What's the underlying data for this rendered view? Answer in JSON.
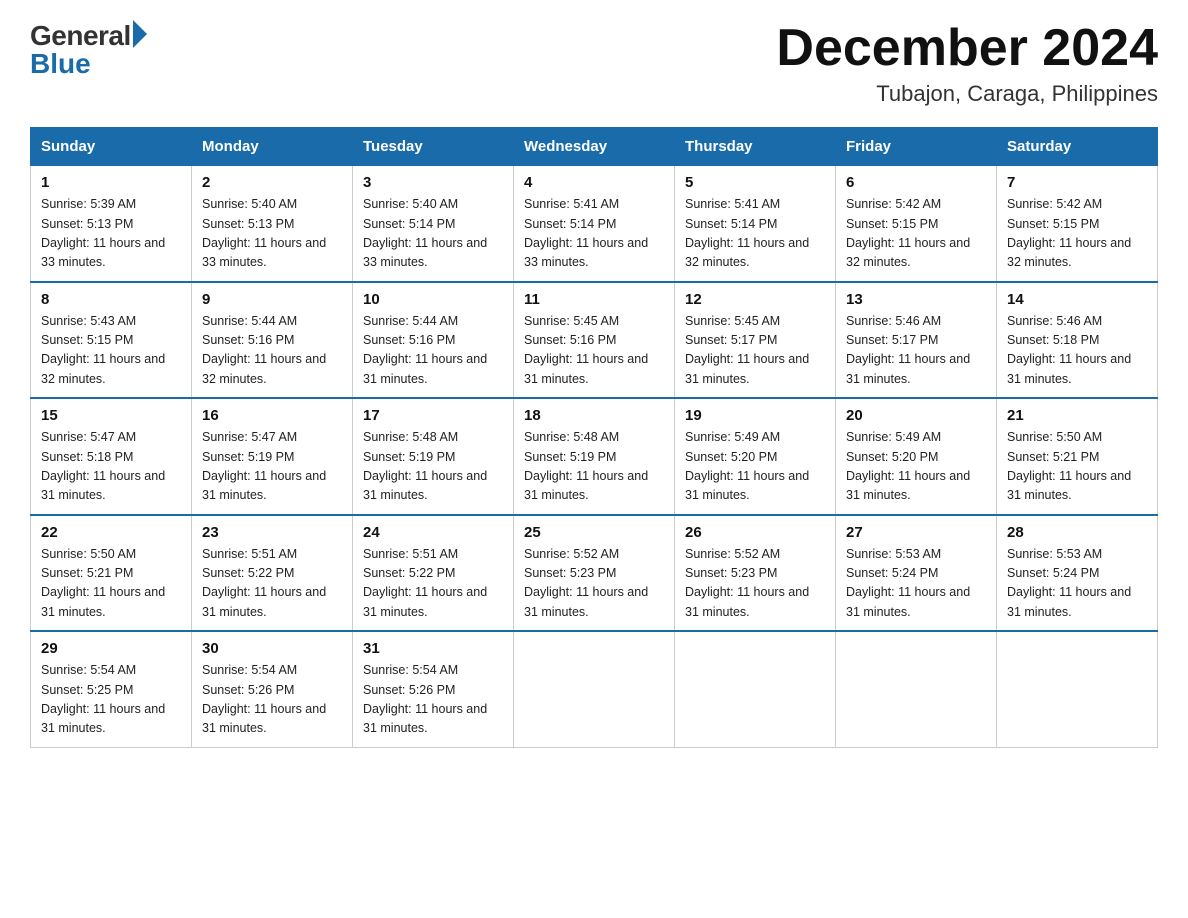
{
  "logo": {
    "general": "General",
    "blue": "Blue"
  },
  "header": {
    "month": "December 2024",
    "location": "Tubajon, Caraga, Philippines"
  },
  "days_of_week": [
    "Sunday",
    "Monday",
    "Tuesday",
    "Wednesday",
    "Thursday",
    "Friday",
    "Saturday"
  ],
  "weeks": [
    [
      {
        "day": "1",
        "sunrise": "5:39 AM",
        "sunset": "5:13 PM",
        "daylight": "11 hours and 33 minutes."
      },
      {
        "day": "2",
        "sunrise": "5:40 AM",
        "sunset": "5:13 PM",
        "daylight": "11 hours and 33 minutes."
      },
      {
        "day": "3",
        "sunrise": "5:40 AM",
        "sunset": "5:14 PM",
        "daylight": "11 hours and 33 minutes."
      },
      {
        "day": "4",
        "sunrise": "5:41 AM",
        "sunset": "5:14 PM",
        "daylight": "11 hours and 33 minutes."
      },
      {
        "day": "5",
        "sunrise": "5:41 AM",
        "sunset": "5:14 PM",
        "daylight": "11 hours and 32 minutes."
      },
      {
        "day": "6",
        "sunrise": "5:42 AM",
        "sunset": "5:15 PM",
        "daylight": "11 hours and 32 minutes."
      },
      {
        "day": "7",
        "sunrise": "5:42 AM",
        "sunset": "5:15 PM",
        "daylight": "11 hours and 32 minutes."
      }
    ],
    [
      {
        "day": "8",
        "sunrise": "5:43 AM",
        "sunset": "5:15 PM",
        "daylight": "11 hours and 32 minutes."
      },
      {
        "day": "9",
        "sunrise": "5:44 AM",
        "sunset": "5:16 PM",
        "daylight": "11 hours and 32 minutes."
      },
      {
        "day": "10",
        "sunrise": "5:44 AM",
        "sunset": "5:16 PM",
        "daylight": "11 hours and 31 minutes."
      },
      {
        "day": "11",
        "sunrise": "5:45 AM",
        "sunset": "5:16 PM",
        "daylight": "11 hours and 31 minutes."
      },
      {
        "day": "12",
        "sunrise": "5:45 AM",
        "sunset": "5:17 PM",
        "daylight": "11 hours and 31 minutes."
      },
      {
        "day": "13",
        "sunrise": "5:46 AM",
        "sunset": "5:17 PM",
        "daylight": "11 hours and 31 minutes."
      },
      {
        "day": "14",
        "sunrise": "5:46 AM",
        "sunset": "5:18 PM",
        "daylight": "11 hours and 31 minutes."
      }
    ],
    [
      {
        "day": "15",
        "sunrise": "5:47 AM",
        "sunset": "5:18 PM",
        "daylight": "11 hours and 31 minutes."
      },
      {
        "day": "16",
        "sunrise": "5:47 AM",
        "sunset": "5:19 PM",
        "daylight": "11 hours and 31 minutes."
      },
      {
        "day": "17",
        "sunrise": "5:48 AM",
        "sunset": "5:19 PM",
        "daylight": "11 hours and 31 minutes."
      },
      {
        "day": "18",
        "sunrise": "5:48 AM",
        "sunset": "5:19 PM",
        "daylight": "11 hours and 31 minutes."
      },
      {
        "day": "19",
        "sunrise": "5:49 AM",
        "sunset": "5:20 PM",
        "daylight": "11 hours and 31 minutes."
      },
      {
        "day": "20",
        "sunrise": "5:49 AM",
        "sunset": "5:20 PM",
        "daylight": "11 hours and 31 minutes."
      },
      {
        "day": "21",
        "sunrise": "5:50 AM",
        "sunset": "5:21 PM",
        "daylight": "11 hours and 31 minutes."
      }
    ],
    [
      {
        "day": "22",
        "sunrise": "5:50 AM",
        "sunset": "5:21 PM",
        "daylight": "11 hours and 31 minutes."
      },
      {
        "day": "23",
        "sunrise": "5:51 AM",
        "sunset": "5:22 PM",
        "daylight": "11 hours and 31 minutes."
      },
      {
        "day": "24",
        "sunrise": "5:51 AM",
        "sunset": "5:22 PM",
        "daylight": "11 hours and 31 minutes."
      },
      {
        "day": "25",
        "sunrise": "5:52 AM",
        "sunset": "5:23 PM",
        "daylight": "11 hours and 31 minutes."
      },
      {
        "day": "26",
        "sunrise": "5:52 AM",
        "sunset": "5:23 PM",
        "daylight": "11 hours and 31 minutes."
      },
      {
        "day": "27",
        "sunrise": "5:53 AM",
        "sunset": "5:24 PM",
        "daylight": "11 hours and 31 minutes."
      },
      {
        "day": "28",
        "sunrise": "5:53 AM",
        "sunset": "5:24 PM",
        "daylight": "11 hours and 31 minutes."
      }
    ],
    [
      {
        "day": "29",
        "sunrise": "5:54 AM",
        "sunset": "5:25 PM",
        "daylight": "11 hours and 31 minutes."
      },
      {
        "day": "30",
        "sunrise": "5:54 AM",
        "sunset": "5:26 PM",
        "daylight": "11 hours and 31 minutes."
      },
      {
        "day": "31",
        "sunrise": "5:54 AM",
        "sunset": "5:26 PM",
        "daylight": "11 hours and 31 minutes."
      },
      null,
      null,
      null,
      null
    ]
  ],
  "labels": {
    "sunrise": "Sunrise:",
    "sunset": "Sunset:",
    "daylight": "Daylight:"
  }
}
